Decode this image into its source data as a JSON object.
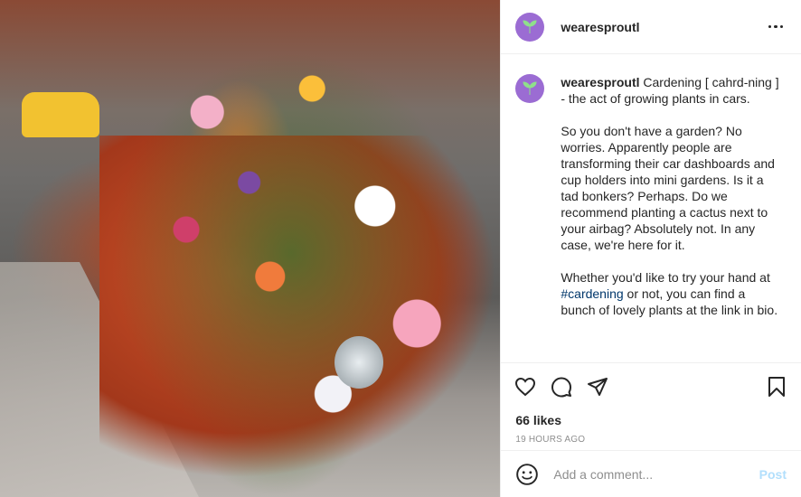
{
  "post": {
    "username": "wearesproutl",
    "caption": {
      "username": "wearesproutl",
      "lead": "Cardening [ cahrd-ning ] - the act of growing plants in cars.",
      "paragraph2": "So you don't have a garden? No worries. Apparently people are transforming their car dashboards and cup holders into mini gardens. Is it a tad bonkers? Perhaps. Do we recommend planting a cactus next to your airbag? Absolutely not. In any case, we're here for it.",
      "paragraph3_before": "Whether you'd like to try your hand at ",
      "hashtag": "#cardening",
      "paragraph3_after": " or not, you can find a bunch of lovely plants at the link in bio."
    },
    "likes": "66 likes",
    "timestamp": "19 HOURS AGO",
    "comment_placeholder": "Add a comment...",
    "post_label": "Post",
    "brand_color": "#9b6cd3"
  }
}
